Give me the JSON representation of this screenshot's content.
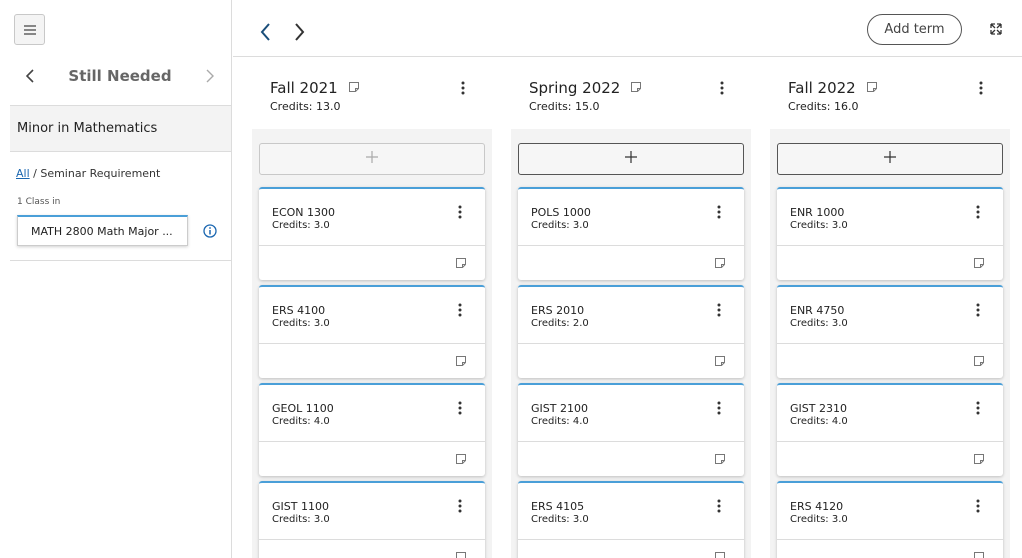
{
  "sidebar": {
    "title": "Still Needed",
    "requirement": "Minor in Mathematics",
    "breadcrumb_all": "All",
    "breadcrumb_sep": " / ",
    "breadcrumb_current": "Seminar Requirement",
    "class_in": "1 Class in",
    "course_chip": "MATH  2800  Math Major ..."
  },
  "toolbar": {
    "add_term": "Add term"
  },
  "terms": [
    {
      "name": "Fall 2021",
      "credits": "Credits:  13.0",
      "courses": [
        {
          "code": "ECON 1300",
          "credits": "Credits: 3.0"
        },
        {
          "code": "ERS 4100",
          "credits": "Credits: 3.0"
        },
        {
          "code": "GEOL 1100",
          "credits": "Credits: 4.0"
        },
        {
          "code": "GIST 1100",
          "credits": "Credits: 3.0"
        }
      ]
    },
    {
      "name": "Spring 2022",
      "credits": "Credits:  15.0",
      "courses": [
        {
          "code": "POLS 1000",
          "credits": "Credits: 3.0"
        },
        {
          "code": "ERS 2010",
          "credits": "Credits: 2.0"
        },
        {
          "code": "GIST 2100",
          "credits": "Credits: 4.0"
        },
        {
          "code": "ERS 4105",
          "credits": "Credits: 3.0"
        }
      ]
    },
    {
      "name": "Fall 2022",
      "credits": "Credits:  16.0",
      "courses": [
        {
          "code": "ENR 1000",
          "credits": "Credits: 3.0"
        },
        {
          "code": "ENR 4750",
          "credits": "Credits: 3.0"
        },
        {
          "code": "GIST 2310",
          "credits": "Credits: 4.0"
        },
        {
          "code": "ERS 4120",
          "credits": "Credits: 3.0"
        }
      ]
    }
  ],
  "colors": {
    "accent": "#4a9fd8",
    "link": "#1a66b0",
    "panel": "#f3f3f3"
  }
}
